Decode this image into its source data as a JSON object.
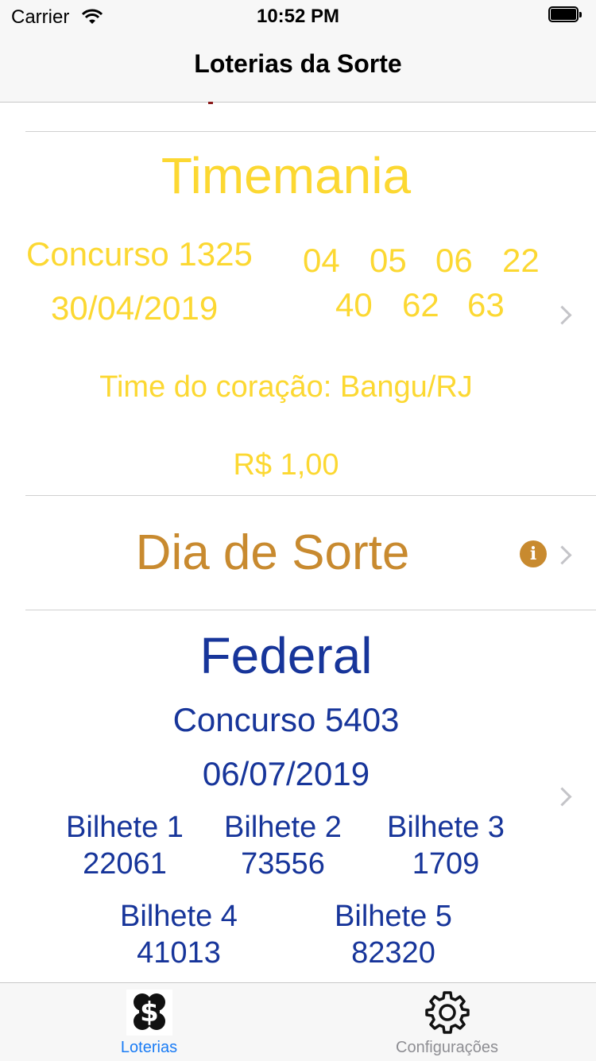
{
  "status": {
    "carrier": "Carrier",
    "time": "10:52 PM"
  },
  "nav": {
    "title": "Loterias da Sorte"
  },
  "timemania": {
    "name": "Timemania",
    "concurso": "Concurso 1325",
    "date": "30/04/2019",
    "numbers_row1": [
      "04",
      "05",
      "06",
      "22"
    ],
    "numbers_row2": [
      "40",
      "62",
      "63"
    ],
    "time_coracao": "Time do coração: Bangu/RJ",
    "prize": "R$ 1,00",
    "color": "#fcd832"
  },
  "dia_de_sorte": {
    "name": "Dia de Sorte",
    "color": "#c88a2f",
    "info_glyph": "i"
  },
  "federal": {
    "name": "Federal",
    "concurso": "Concurso 5403",
    "date": "06/07/2019",
    "color": "#17359a",
    "bilhetes": [
      {
        "label": "Bilhete 1",
        "number": "22061"
      },
      {
        "label": "Bilhete 2",
        "number": "73556"
      },
      {
        "label": "Bilhete 3",
        "number": "1709"
      },
      {
        "label": "Bilhete 4",
        "number": "41013"
      },
      {
        "label": "Bilhete 5",
        "number": "82320"
      }
    ]
  },
  "tabbar": {
    "tabs": [
      {
        "label": "Loterias",
        "icon": "clover-dollar-icon",
        "active": true
      },
      {
        "label": "Configurações",
        "icon": "gear-icon",
        "active": false
      }
    ],
    "active_color": "#1a7cf5",
    "inactive_color": "#8e8e93"
  }
}
